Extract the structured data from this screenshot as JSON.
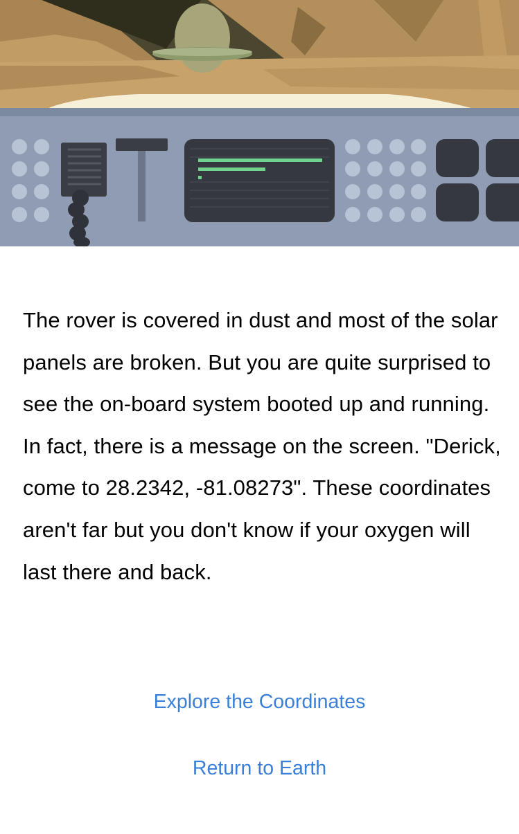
{
  "scene": {
    "illustration": "rover-dashboard-landscape-illustration",
    "colors": {
      "sky_dark": "#3b3a26",
      "sand": "#b8955c",
      "sand_light": "#c9a46a",
      "dashboard": "#8f9db4",
      "dashboard_dark": "#3a3d44",
      "screen_text": "#6fd38f"
    }
  },
  "story": {
    "text": "The rover is covered in dust and most of the solar panels are broken. But you are quite surprised to see the on-board system booted up and running. In fact, there is a message on the screen. \"Derick, come to 28.2342, -81.08273\". These coordinates aren't far but you don't know if your oxygen will last there and back."
  },
  "choices": [
    {
      "label": "Explore the Coordinates"
    },
    {
      "label": "Return to Earth"
    }
  ],
  "accent_color": "#3a7fd8"
}
